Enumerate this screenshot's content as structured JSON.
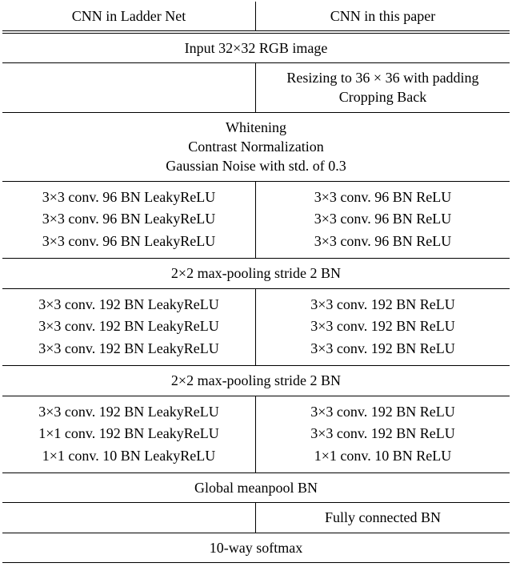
{
  "header": {
    "left": "CNN in Ladder Net",
    "right": "CNN in this paper"
  },
  "input_row": "Input 32×32 RGB image",
  "preproc_right": "Resizing to 36 × 36 with padding\nCropping Back",
  "common_preproc": "Whitening\nContrast Normalization\nGaussian Noise with std. of 0.3",
  "block1": {
    "left": [
      "3×3 conv. 96 BN LeakyReLU",
      "3×3 conv. 96 BN LeakyReLU",
      "3×3 conv. 96 BN LeakyReLU"
    ],
    "right": [
      "3×3 conv. 96 BN ReLU",
      "3×3 conv. 96 BN ReLU",
      "3×3 conv. 96 BN ReLU"
    ]
  },
  "pool1": "2×2 max-pooling stride 2 BN",
  "block2": {
    "left": [
      "3×3 conv. 192 BN LeakyReLU",
      "3×3 conv. 192 BN LeakyReLU",
      "3×3 conv. 192 BN LeakyReLU"
    ],
    "right": [
      "3×3 conv. 192 BN ReLU",
      "3×3 conv. 192 BN ReLU",
      "3×3 conv. 192 BN ReLU"
    ]
  },
  "pool2": "2×2 max-pooling stride 2 BN",
  "block3": {
    "left": [
      "3×3 conv. 192 BN LeakyReLU",
      "1×1 conv. 192 BN LeakyReLU",
      "1×1 conv. 10   BN LeakyReLU"
    ],
    "right": [
      "3×3 conv. 192 BN ReLU",
      "3×3 conv. 192 BN ReLU",
      "1×1 conv. 10   BN ReLU"
    ]
  },
  "global_pool": "Global meanpool BN",
  "fc_right": "Fully connected BN",
  "softmax": "10-way softmax",
  "chart_data": {
    "type": "table",
    "title": "CNN architecture comparison",
    "columns": [
      "CNN in Ladder Net",
      "CNN in this paper"
    ],
    "rows": [
      {
        "span": true,
        "text": "Input 32×32 RGB image"
      },
      {
        "span": false,
        "left": "",
        "right": "Resizing to 36 × 36 with padding; Cropping Back"
      },
      {
        "span": true,
        "text": "Whitening; Contrast Normalization; Gaussian Noise with std. of 0.3"
      },
      {
        "span": false,
        "left": "3×3 conv. 96 BN LeakyReLU ×3",
        "right": "3×3 conv. 96 BN ReLU ×3"
      },
      {
        "span": true,
        "text": "2×2 max-pooling stride 2 BN"
      },
      {
        "span": false,
        "left": "3×3 conv. 192 BN LeakyReLU ×3",
        "right": "3×3 conv. 192 BN ReLU ×3"
      },
      {
        "span": true,
        "text": "2×2 max-pooling stride 2 BN"
      },
      {
        "span": false,
        "left": "3×3 conv. 192 BN LeakyReLU; 1×1 conv. 192 BN LeakyReLU; 1×1 conv. 10 BN LeakyReLU",
        "right": "3×3 conv. 192 BN ReLU; 3×3 conv. 192 BN ReLU; 1×1 conv. 10 BN ReLU"
      },
      {
        "span": true,
        "text": "Global meanpool BN"
      },
      {
        "span": false,
        "left": "",
        "right": "Fully connected BN"
      },
      {
        "span": true,
        "text": "10-way softmax"
      }
    ]
  }
}
